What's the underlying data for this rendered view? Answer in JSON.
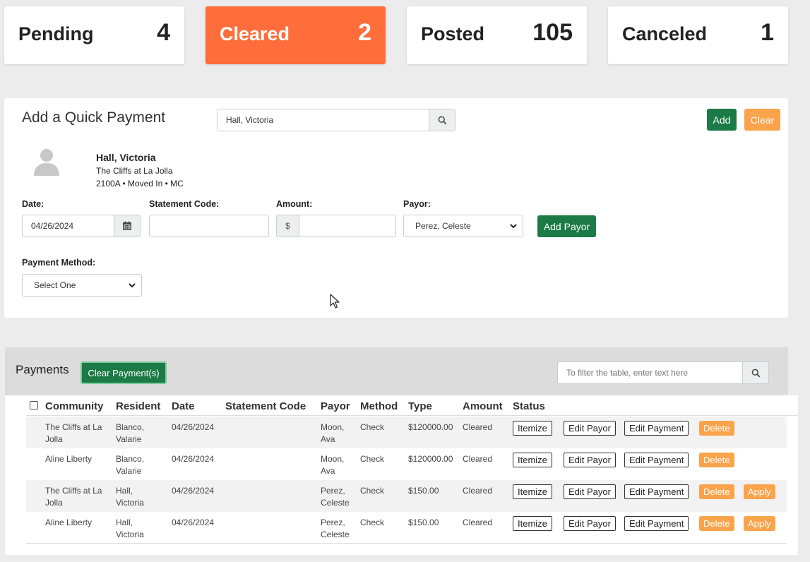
{
  "status_cards": [
    {
      "label": "Pending",
      "count": "4"
    },
    {
      "label": "Cleared",
      "count": "2"
    },
    {
      "label": "Posted",
      "count": "105"
    },
    {
      "label": "Canceled",
      "count": "1"
    }
  ],
  "quick_payment": {
    "title": "Add a Quick Payment",
    "search_value": "Hall, Victoria",
    "add_label": "Add",
    "clear_label": "Clear",
    "resident": {
      "name": "Hall, Victoria",
      "community": "The Cliffs at La Jolla",
      "info": "2100A • Moved In • MC"
    },
    "date_label": "Date:",
    "date_value": "04/26/2024",
    "statement_code_label": "Statement Code:",
    "amount_label": "Amount:",
    "amount_prefix": "$",
    "payor_label": "Payor:",
    "payor_selected": "Perez, Celeste",
    "add_payor_label": "Add Payor",
    "payment_method_label": "Payment Method:",
    "payment_method_selected": "Select One"
  },
  "payments": {
    "title": "Payments",
    "clear_payments_label": "Clear Payment(s)",
    "filter_placeholder": "To filter the table, enter text here",
    "columns": [
      "Community",
      "Resident",
      "Date",
      "Statement Code",
      "Payor",
      "Method",
      "Type",
      "Amount",
      "Status"
    ],
    "rows": [
      {
        "community": "The Cliffs at La Jolla",
        "resident": "Blanco, Valarie",
        "date": "04/26/2024",
        "statement_code": "",
        "payor": "Moon, Ava",
        "method": "Check",
        "amount": "$120000.00",
        "status": "Cleared",
        "apply": false
      },
      {
        "community": "Aline Liberty",
        "resident": "Blanco, Valarie",
        "date": "04/26/2024",
        "statement_code": "",
        "payor": "Moon, Ava",
        "method": "Check",
        "amount": "$120000.00",
        "status": "Cleared",
        "apply": false
      },
      {
        "community": "The Cliffs at La Jolla",
        "resident": "Hall, Victoria",
        "date": "04/26/2024",
        "statement_code": "",
        "payor": "Perez, Celeste",
        "method": "Check",
        "amount": "$150.00",
        "status": "Cleared",
        "apply": true
      },
      {
        "community": "Aline Liberty",
        "resident": "Hall, Victoria",
        "date": "04/26/2024",
        "statement_code": "",
        "payor": "Perez, Celeste",
        "method": "Check",
        "amount": "$150.00",
        "status": "Cleared",
        "apply": true
      }
    ],
    "actions": {
      "itemize": "Itemize",
      "edit_payor": "Edit Payor",
      "edit_payment": "Edit Payment",
      "delete": "Delete",
      "apply": "Apply"
    }
  },
  "colors": {
    "active_card": "#ff6d3b",
    "green": "#1b7a46",
    "orange": "#f9a34a"
  },
  "icons": [
    "search-icon",
    "calendar-icon",
    "avatar-placeholder-icon",
    "chevron-down-icon",
    "cursor-icon"
  ]
}
